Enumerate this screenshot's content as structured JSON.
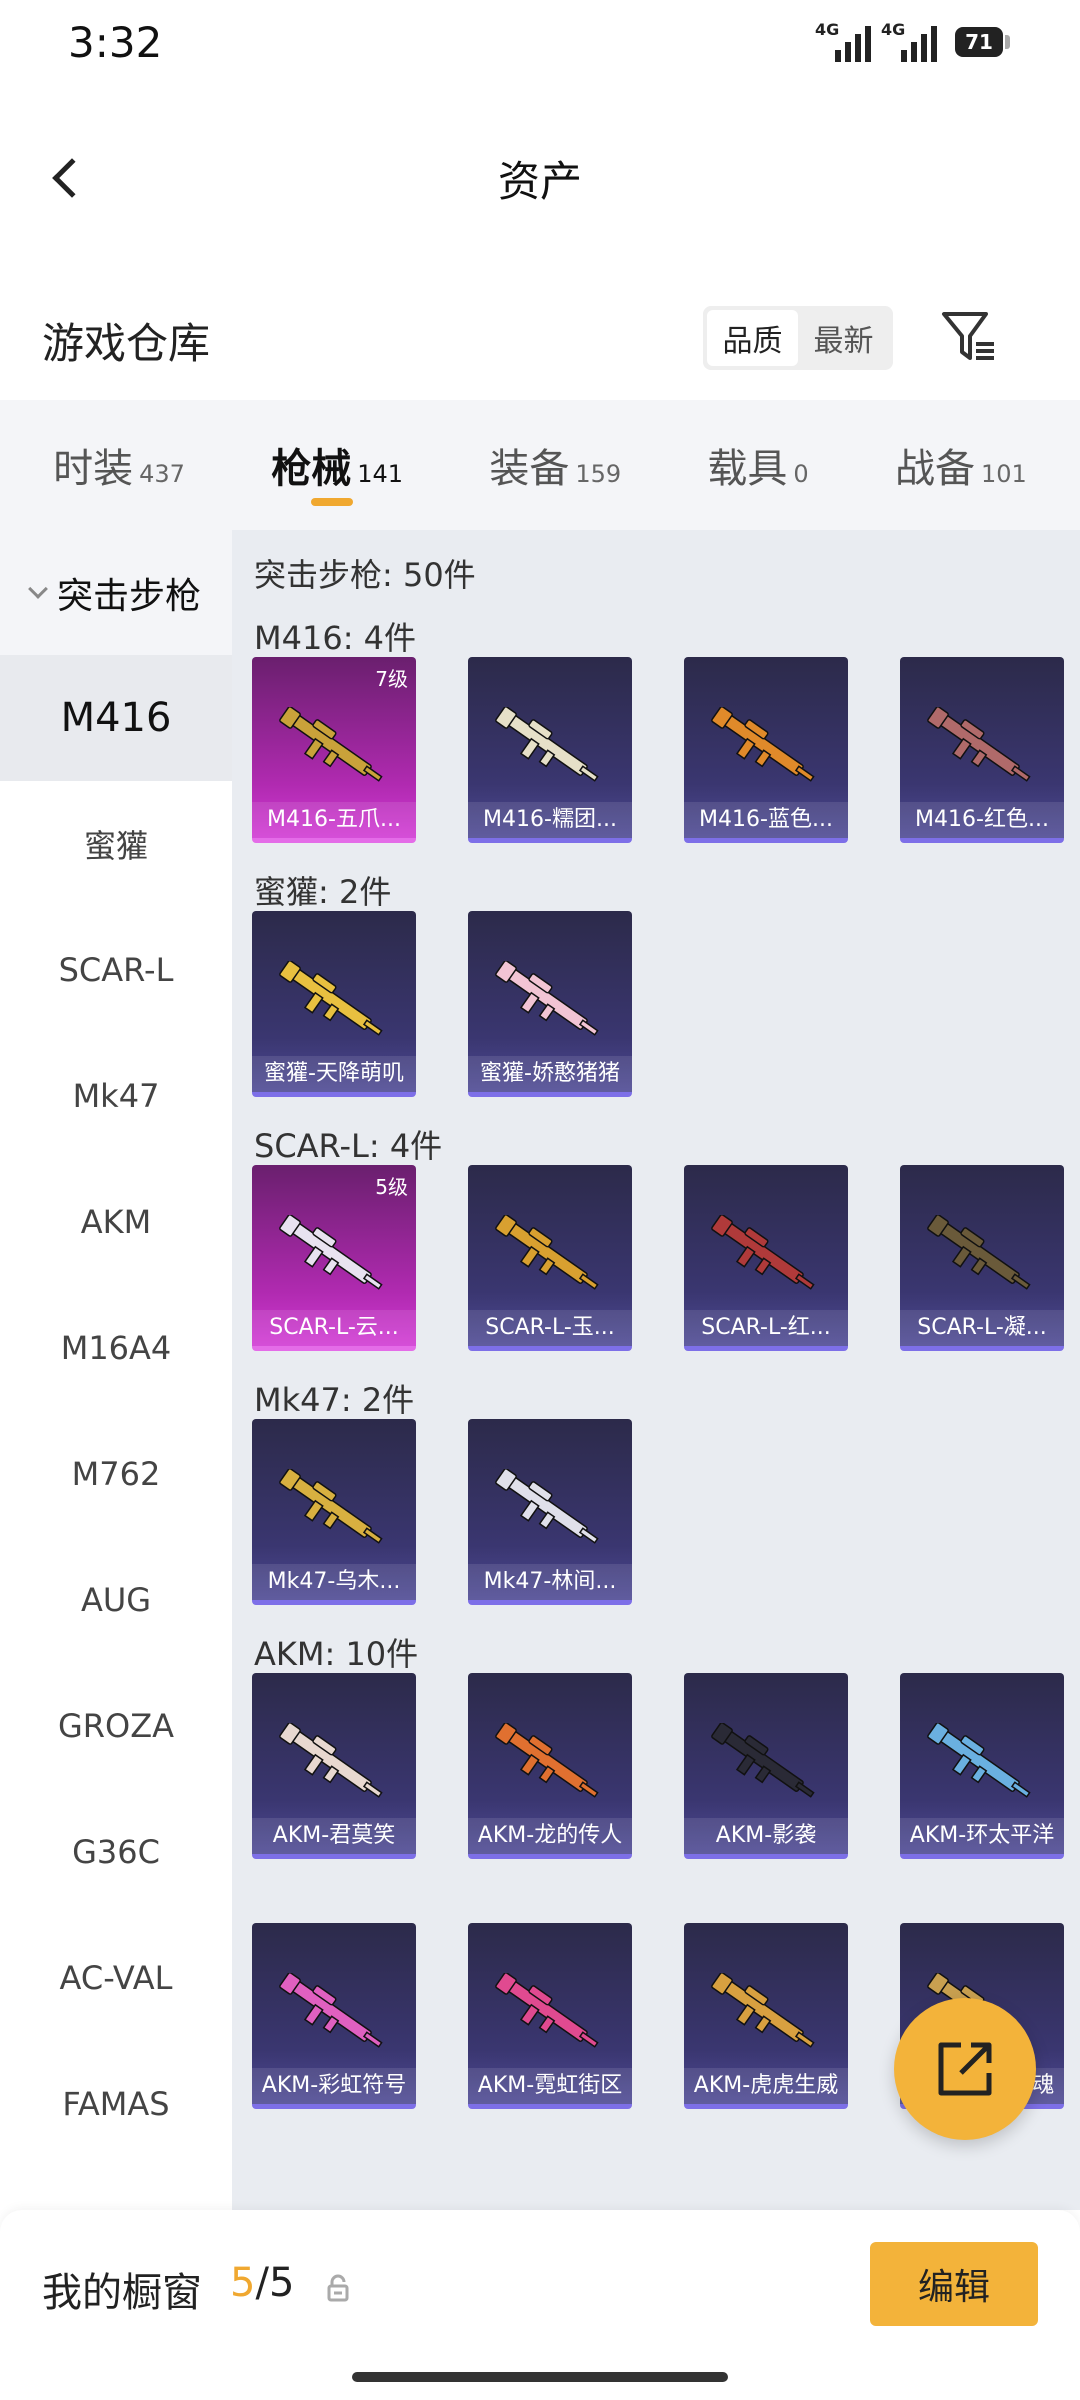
{
  "status_bar": {
    "time": "3:32",
    "network_1": "4G",
    "network_2": "4G",
    "battery": "71"
  },
  "header": {
    "title": "资产"
  },
  "warehouse": {
    "title": "游戏仓库",
    "sort_quality": "品质",
    "sort_latest": "最新"
  },
  "tabs": [
    {
      "label": "时装",
      "count": "437"
    },
    {
      "label": "枪械",
      "count": "141"
    },
    {
      "label": "装备",
      "count": "159"
    },
    {
      "label": "载具",
      "count": "0"
    },
    {
      "label": "战备",
      "count": "101"
    }
  ],
  "sidebar": {
    "group": "突击步枪",
    "items": [
      "M416",
      "蜜獾",
      "SCAR-L",
      "Mk47",
      "AKM",
      "M16A4",
      "M762",
      "AUG",
      "GROZA",
      "G36C",
      "AC-VAL",
      "FAMAS"
    ]
  },
  "content": {
    "total": "突击步枪: 50件",
    "sections": [
      {
        "title": "M416: 4件",
        "items": [
          {
            "label": "M416-五爪...",
            "level": "7级",
            "rarity": "legend",
            "gun_color": "#c9a23a"
          },
          {
            "label": "M416-糯团...",
            "level": "",
            "rarity": "epic",
            "gun_color": "#e6e0c8"
          },
          {
            "label": "M416-蓝色...",
            "level": "",
            "rarity": "epic",
            "gun_color": "#e08a2a"
          },
          {
            "label": "M416-红色...",
            "level": "",
            "rarity": "epic",
            "gun_color": "#b06a6a"
          }
        ]
      },
      {
        "title": "蜜獾: 2件",
        "items": [
          {
            "label": "蜜獾-天降萌叽",
            "level": "",
            "rarity": "epic",
            "gun_color": "#e8c040"
          },
          {
            "label": "蜜獾-娇憨猪猪",
            "level": "",
            "rarity": "epic",
            "gun_color": "#f2c4d4"
          }
        ]
      },
      {
        "title": "SCAR-L: 4件",
        "items": [
          {
            "label": "SCAR-L-云...",
            "level": "5级",
            "rarity": "legend",
            "gun_color": "#e8e2f0"
          },
          {
            "label": "SCAR-L-玉...",
            "level": "",
            "rarity": "epic",
            "gun_color": "#d8a030"
          },
          {
            "label": "SCAR-L-红...",
            "level": "",
            "rarity": "epic",
            "gun_color": "#b03a3a"
          },
          {
            "label": "SCAR-L-凝...",
            "level": "",
            "rarity": "epic",
            "gun_color": "#6a5a3a"
          }
        ]
      },
      {
        "title": "Mk47: 2件",
        "items": [
          {
            "label": "Mk47-乌木...",
            "level": "",
            "rarity": "epic",
            "gun_color": "#d8b040"
          },
          {
            "label": "Mk47-林间...",
            "level": "",
            "rarity": "epic",
            "gun_color": "#e0e0ea"
          }
        ]
      },
      {
        "title": "AKM: 10件",
        "items": [
          {
            "label": "AKM-君莫笑",
            "level": "",
            "rarity": "epic",
            "gun_color": "#e8d8d0"
          },
          {
            "label": "AKM-龙的传人",
            "level": "",
            "rarity": "epic",
            "gun_color": "#e07030"
          },
          {
            "label": "AKM-影袭",
            "level": "",
            "rarity": "epic",
            "gun_color": "#2a2a36"
          },
          {
            "label": "AKM-环太平洋",
            "level": "",
            "rarity": "epic",
            "gun_color": "#6ab0e0"
          }
        ]
      },
      {
        "title": "",
        "items": [
          {
            "label": "AKM-彩虹符号",
            "level": "",
            "rarity": "epic",
            "gun_color": "#e060c0"
          },
          {
            "label": "AKM-霓虹街区",
            "level": "",
            "rarity": "epic",
            "gun_color": "#e04a90"
          },
          {
            "label": "AKM-虎虎生威",
            "level": "",
            "rarity": "epic",
            "gun_color": "#d8a040"
          },
          {
            "label": "AKM-破晓战魂",
            "level": "",
            "rarity": "epic",
            "gun_color": "#c8a050"
          }
        ]
      }
    ]
  },
  "bottom_bar": {
    "label": "我的橱窗",
    "current": "5",
    "separator": "/",
    "max": "5",
    "edit_label": "编辑"
  }
}
